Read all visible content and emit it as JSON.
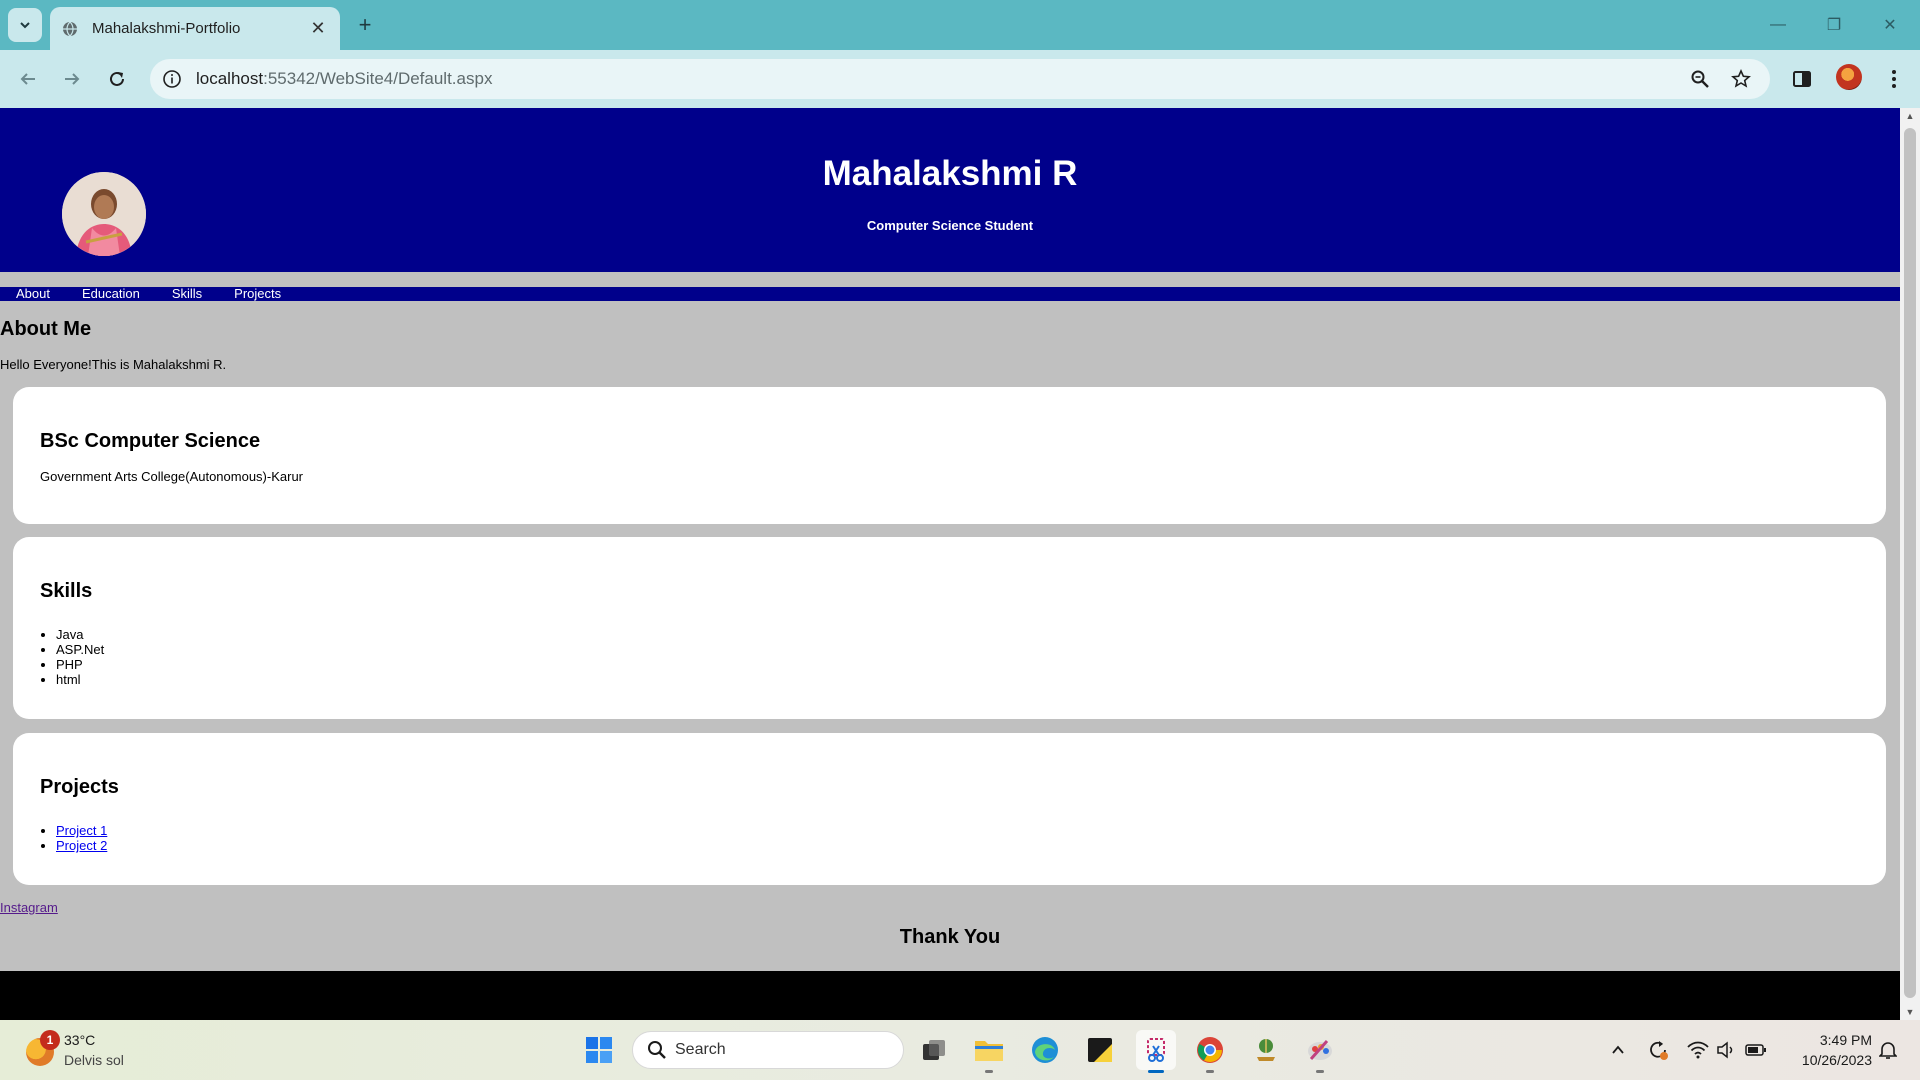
{
  "browser": {
    "tab_title": "Mahalakshmi-Portfolio",
    "url_host": "localhost",
    "url_path": ":55342/WebSite4/Default.aspx"
  },
  "page": {
    "header": {
      "name": "Mahalakshmi R",
      "subtitle": "Computer Science Student"
    },
    "nav": [
      "About",
      "Education",
      "Skills",
      "Projects"
    ],
    "about": {
      "heading": "About Me",
      "text": "Hello Everyone!This is Mahalakshmi R."
    },
    "education": {
      "heading": "BSc Computer Science",
      "college": "Government Arts College(Autonomous)-Karur"
    },
    "skills": {
      "heading": "Skills",
      "items": [
        "Java",
        "ASP.Net",
        "PHP",
        "html"
      ]
    },
    "projects": {
      "heading": "Projects",
      "items": [
        "Project 1",
        "Project 2"
      ]
    },
    "instagram_link": "Instagram",
    "thanks": "Thank You",
    "colors": {
      "header_bg": "#00008b",
      "page_bg": "#c0c0c0",
      "footer_bg": "#000000"
    }
  },
  "taskbar": {
    "weather_badge": "1",
    "temperature": "33°C",
    "weather_condition": "Delvis sol",
    "search_label": "Search",
    "time": "3:49 PM",
    "date": "10/26/2023"
  }
}
